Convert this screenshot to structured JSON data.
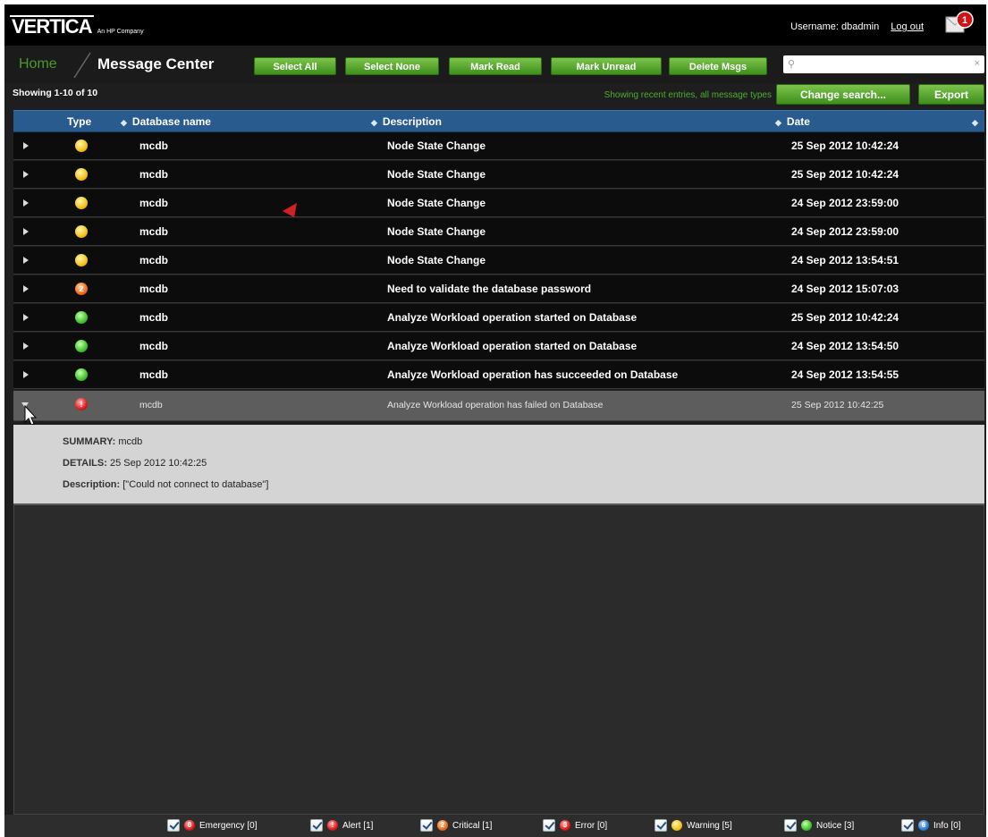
{
  "header": {
    "logo_text": "VERTICA",
    "logo_tagline": "An HP Company",
    "username_text": "Username: dbadmin",
    "logout_label": "Log out",
    "notification_count": "1"
  },
  "nav": {
    "home_label": "Home",
    "page_title": "Message Center",
    "buttons": {
      "select_all": "Select All",
      "select_none": "Select None",
      "mark_read": "Mark Read",
      "mark_unread": "Mark Unread",
      "delete_msgs": "Delete Msgs"
    },
    "search": {
      "value": "",
      "placeholder": ""
    }
  },
  "toolbar": {
    "showing_text": "Showing 1-10 of 10",
    "filter_info": "Showing recent entries, all message types",
    "change_search_label": "Change search...",
    "export_label": "Export"
  },
  "table": {
    "columns": [
      "Type",
      "Database name",
      "Description",
      "Date"
    ],
    "rows": [
      {
        "type": "warning",
        "database": "mcdb",
        "description": "Node State Change",
        "date": "25 Sep 2012 10:42:24"
      },
      {
        "type": "warning",
        "database": "mcdb",
        "description": "Node State Change",
        "date": "25 Sep 2012 10:42:24"
      },
      {
        "type": "warning",
        "database": "mcdb",
        "description": "Node State Change",
        "date": "24 Sep 2012 23:59:00"
      },
      {
        "type": "warning",
        "database": "mcdb",
        "description": "Node State Change",
        "date": "24 Sep 2012 23:59:00"
      },
      {
        "type": "warning",
        "database": "mcdb",
        "description": "Node State Change",
        "date": "24 Sep 2012 13:54:51"
      },
      {
        "type": "critical",
        "database": "mcdb",
        "description": "Need to validate the database password",
        "date": "24 Sep 2012 15:07:03"
      },
      {
        "type": "notice",
        "database": "mcdb",
        "description": "Analyze Workload operation started on Database",
        "date": "25 Sep 2012 10:42:24"
      },
      {
        "type": "notice",
        "database": "mcdb",
        "description": "Analyze Workload operation started on Database",
        "date": "24 Sep 2012 13:54:50"
      },
      {
        "type": "notice",
        "database": "mcdb",
        "description": "Analyze Workload operation has succeeded on Database",
        "date": "24 Sep 2012 13:54:55"
      },
      {
        "type": "alert",
        "database": "mcdb",
        "description": "Analyze Workload operation has failed on Database",
        "date": "25 Sep 2012 10:42:25"
      }
    ]
  },
  "detail": {
    "summary_key": "SUMMARY:",
    "summary_value": "mcdb",
    "details_key": "DETAILS:",
    "details_value": "25 Sep 2012 10:42:25",
    "description_key": "Description:",
    "description_value": "[\"Could not connect to database\"]"
  },
  "legend": [
    {
      "label": "Emergency [0]",
      "glyph": "0",
      "color": "#e01b1b"
    },
    {
      "label": "Alert [1]",
      "glyph": "!",
      "color": "#e01b1b"
    },
    {
      "label": "Critical [1]",
      "glyph": "2",
      "color": "#ef6a1b"
    },
    {
      "label": "Error [0]",
      "glyph": "3",
      "color": "#e01b1b"
    },
    {
      "label": "Warning [5]",
      "glyph": "",
      "color": "#f2c21a"
    },
    {
      "label": "Notice [3]",
      "glyph": "",
      "color": "#3fc52c"
    },
    {
      "label": "Info [0]",
      "glyph": "6",
      "color": "#2d7ed9"
    }
  ],
  "colors": {
    "accent_green": "#4c9a2a",
    "header_blue": "#2a5b8f",
    "warning": "#f2c21a",
    "critical": "#ef6a1b",
    "notice": "#3fc52c",
    "alert": "#e01b1b",
    "info": "#2d7ed9"
  }
}
